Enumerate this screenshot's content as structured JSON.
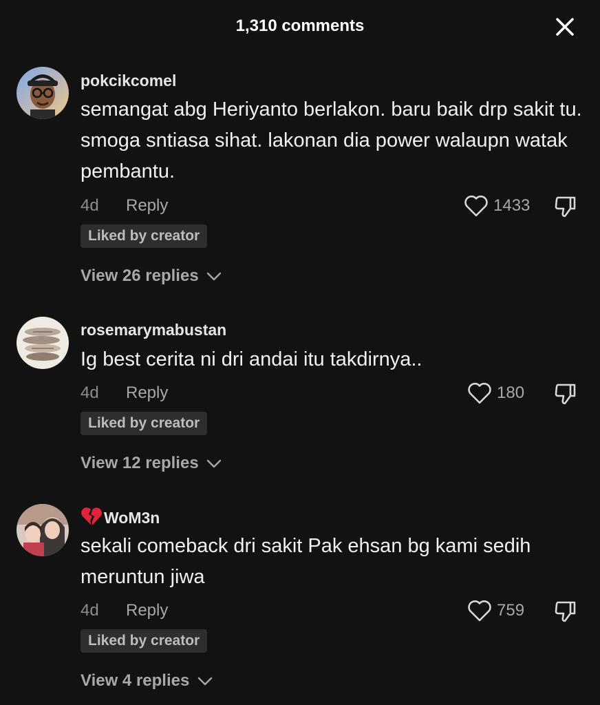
{
  "header": {
    "title": "1,310 comments"
  },
  "comments": [
    {
      "username": "pokcikcomel",
      "text": "semangat abg Heriyanto berlakon. baru baik drp sakit tu. smoga sntiasa sihat. lakonan dia power walaupn watak pembantu.",
      "time": "4d",
      "reply_label": "Reply",
      "likes": "1433",
      "badge": "Liked by creator",
      "view_replies": "View 26 replies"
    },
    {
      "username": "rosemarymabustan",
      "text": "Ig best cerita ni dri andai itu takdirnya..",
      "time": "4d",
      "reply_label": "Reply",
      "likes": "180",
      "badge": "Liked by creator",
      "view_replies": "View 12 replies"
    },
    {
      "username": "WoM3n",
      "username_icon": "broken-heart-emoji",
      "text": "sekali comeback dri sakit Pak ehsan bg kami sedih meruntun jiwa",
      "time": "4d",
      "reply_label": "Reply",
      "likes": "759",
      "badge": "Liked by creator",
      "view_replies": "View 4 replies"
    }
  ],
  "colors": {
    "background": "#121212",
    "secondary_text": "#a8a8a8",
    "badge_bg": "#2e2e2e"
  }
}
